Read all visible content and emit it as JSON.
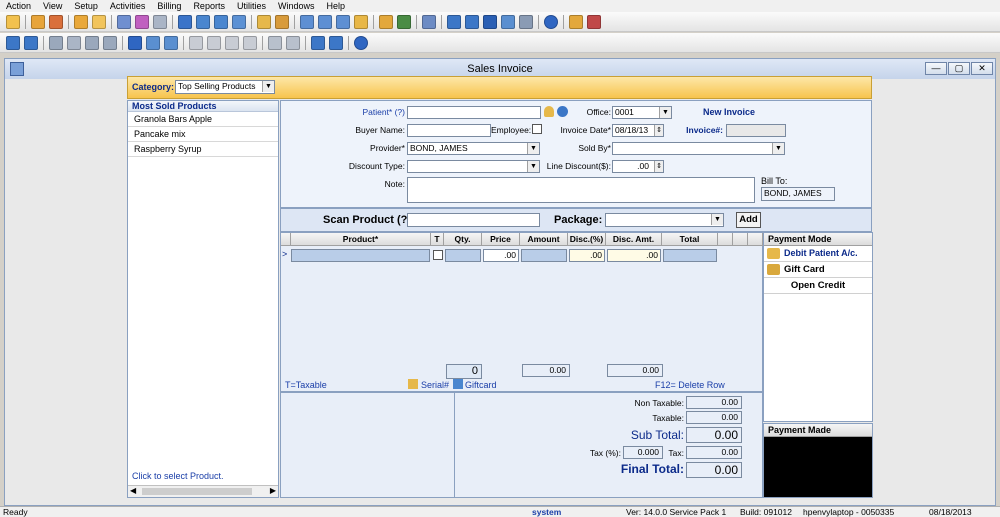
{
  "menu": [
    "Action",
    "View",
    "Setup",
    "Activities",
    "Billing",
    "Reports",
    "Utilities",
    "Windows",
    "Help"
  ],
  "window": {
    "title": "Sales Invoice",
    "min": "—",
    "max": "▢",
    "close": "✕"
  },
  "category": {
    "label": "Category:",
    "value": "Top Selling Products"
  },
  "left_panel": {
    "header": "Most Sold Products",
    "items": [
      "Granola Bars Apple",
      "Pancake mix",
      "Raspberry Syrup"
    ],
    "hint": "Click to select Product."
  },
  "form": {
    "patient_label": "Patient* (?)",
    "office_label": "Office:",
    "office_value": "0001",
    "new_invoice": "New Invoice",
    "buyer_label": "Buyer Name:",
    "employee_label": "Employee:",
    "invoice_date_label": "Invoice Date*",
    "invoice_date": "08/18/13",
    "invoice_no_label": "Invoice#:",
    "provider_label": "Provider*",
    "provider_value": "BOND, JAMES",
    "sold_by_label": "Sold By*",
    "discount_type_label": "Discount Type:",
    "line_discount_label": "Line Discount($):",
    "line_discount": ".00",
    "note_label": "Note:",
    "bill_to_label": "Bill To:",
    "bill_to_value": "BOND, JAMES"
  },
  "scan": {
    "label": "Scan Product (?)",
    "package_label": "Package:",
    "add_button": "Add"
  },
  "grid": {
    "headers": [
      "Product*",
      "T",
      "Qty.",
      "Price",
      "Amount",
      "Disc.(%)",
      "Disc. Amt.",
      "Total"
    ],
    "row_price": ".00",
    "row_disc_pct": ".00",
    "row_disc_amt": ".00",
    "qty_total": "0",
    "amount_total": "0.00",
    "disc_total": "0.00",
    "taxable_note": "T=Taxable",
    "serial": "Serial#",
    "giftcard": "Giftcard",
    "f12": "F12= Delete Row"
  },
  "payment_mode": {
    "header": "Payment Mode",
    "items": [
      "Debit Patient A/c.",
      "Gift Card",
      "Open Credit"
    ]
  },
  "payment_made": {
    "header": "Payment Made"
  },
  "totals": {
    "non_taxable_label": "Non Taxable:",
    "non_taxable": "0.00",
    "taxable_label": "Taxable:",
    "taxable": "0.00",
    "sub_total_label": "Sub Total:",
    "sub_total": "0.00",
    "tax_pct_label": "Tax (%):",
    "tax_pct": "0.000",
    "tax_label": "Tax:",
    "tax": "0.00",
    "final_total_label": "Final Total:",
    "final_total": "0.00"
  },
  "status": {
    "ready": "Ready",
    "user": "system",
    "version": "Ver: 14.0.0 Service Pack 1",
    "build": "Build: 091012",
    "machine": "hpenvylaptop - 0050335",
    "date": "08/18/2013"
  }
}
